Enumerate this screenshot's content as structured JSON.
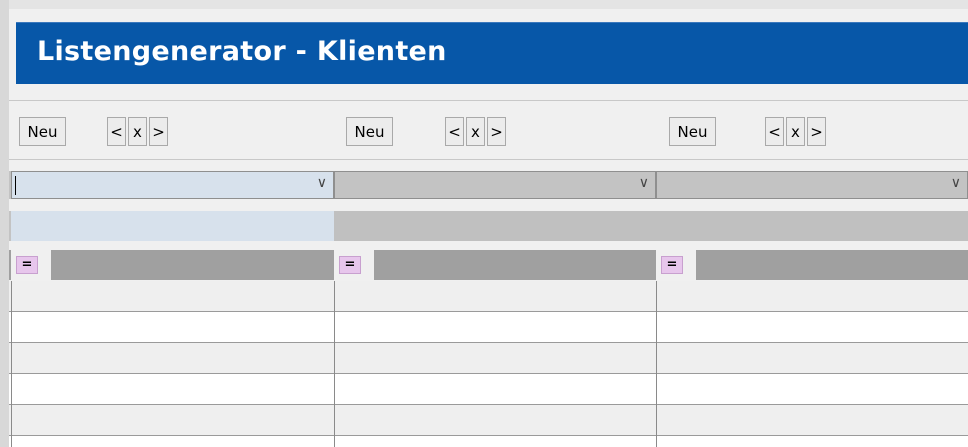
{
  "window": {
    "title": "Listengenerator - Klienten"
  },
  "columns": [
    {
      "new_label": "Neu",
      "prev_label": "<",
      "remove_label": "x",
      "next_label": ">",
      "combo_value": "",
      "filter_value": "",
      "equals_label": "="
    },
    {
      "new_label": "Neu",
      "prev_label": "<",
      "remove_label": "x",
      "next_label": ">",
      "combo_value": "",
      "filter_value": "",
      "equals_label": "="
    },
    {
      "new_label": "Neu",
      "prev_label": "<",
      "remove_label": "x",
      "next_label": ">",
      "combo_value": "",
      "filter_value": "",
      "equals_label": "="
    }
  ],
  "dropdown_glyph": "∨",
  "colors": {
    "title_bar": "#0757a8",
    "title_text": "#ffffff",
    "selected_column": "#d7e1ec",
    "inactive_column": "#c3c3c3",
    "header": "#a0a0a0",
    "equals_button": "#e7c6ec",
    "row_alt": "#efefef",
    "row": "#ffffff"
  },
  "rows": [
    {
      "cells": [
        "",
        "",
        ""
      ]
    },
    {
      "cells": [
        "",
        "",
        ""
      ]
    },
    {
      "cells": [
        "",
        "",
        ""
      ]
    },
    {
      "cells": [
        "",
        "",
        ""
      ]
    },
    {
      "cells": [
        "",
        "",
        ""
      ]
    }
  ]
}
